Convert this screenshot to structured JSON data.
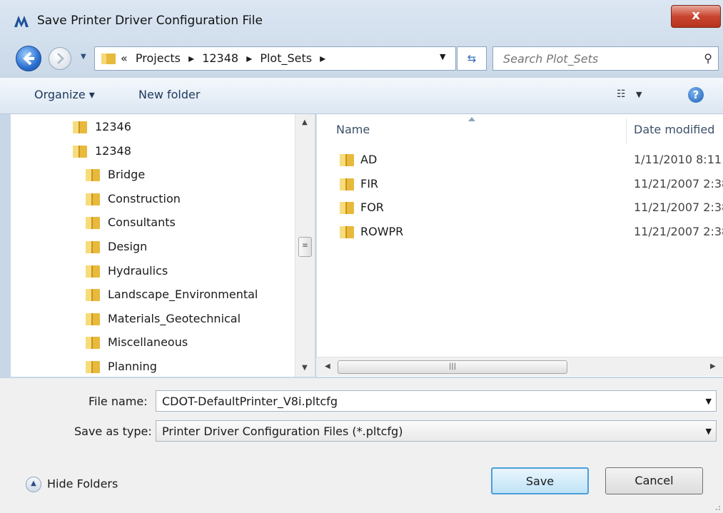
{
  "window": {
    "title": "Save Printer Driver Configuration File",
    "close_label": "x"
  },
  "address": {
    "prefix": "«",
    "crumbs": [
      "Projects",
      "12348",
      "Plot_Sets"
    ],
    "separator": "▸"
  },
  "search": {
    "placeholder": "Search Plot_Sets"
  },
  "toolbar": {
    "organize_label": "Organize ▾",
    "new_folder_label": "New folder",
    "help_label": "?"
  },
  "tree": {
    "items": [
      {
        "label": "12346",
        "level": 0
      },
      {
        "label": "12348",
        "level": 0
      },
      {
        "label": "Bridge",
        "level": 1
      },
      {
        "label": "Construction",
        "level": 1
      },
      {
        "label": "Consultants",
        "level": 1
      },
      {
        "label": "Design",
        "level": 1
      },
      {
        "label": "Hydraulics",
        "level": 1
      },
      {
        "label": "Landscape_Environmental",
        "level": 1
      },
      {
        "label": "Materials_Geotechnical",
        "level": 1
      },
      {
        "label": "Miscellaneous",
        "level": 1
      },
      {
        "label": "Planning",
        "level": 1
      }
    ]
  },
  "files": {
    "columns": {
      "name": "Name",
      "date": "Date modified"
    },
    "rows": [
      {
        "name": "AD",
        "date": "1/11/2010 8:11"
      },
      {
        "name": "FIR",
        "date": "11/21/2007 2:38"
      },
      {
        "name": "FOR",
        "date": "11/21/2007 2:38"
      },
      {
        "name": "ROWPR",
        "date": "11/21/2007 2:38"
      }
    ]
  },
  "form": {
    "file_name_label": "File name:",
    "file_name_value": "CDOT-DefaultPrinter_V8i.pltcfg",
    "save_type_label": "Save as type:",
    "save_type_value": "Printer Driver Configuration Files (*.pltcfg)"
  },
  "footer": {
    "hide_folders_label": "Hide Folders",
    "save_label": "Save",
    "cancel_label": "Cancel"
  },
  "colors": {
    "accent": "#4a9fd8",
    "folder": "#e8b93b",
    "close": "#c9452f"
  }
}
